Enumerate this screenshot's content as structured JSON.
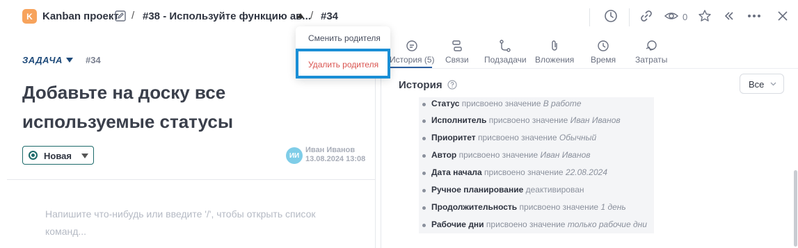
{
  "header": {
    "project_badge": "K",
    "project_name": "Kanban проект",
    "crumb_parent": "#38 - Используйте функцию ав...",
    "crumb_current": "#34",
    "separator": "/",
    "watchers_count": "0"
  },
  "task": {
    "type_label": "ЗАДАЧА",
    "number": "#34",
    "title": "Добавьте на доску все используемые статусы",
    "status": "Новая",
    "author_initials": "ИИ",
    "author_name": "Иван Иванов",
    "author_date": "13.08.2024 13:08",
    "editor_placeholder": "Напишите что-нибудь или введите '/', чтобы открыть список команд..."
  },
  "menu": {
    "items": [
      "Сменить родителя",
      "Удалить родителя"
    ]
  },
  "tabs": [
    {
      "label": "История (5)",
      "icon": "history-icon"
    },
    {
      "label": "Связи",
      "icon": "links-icon"
    },
    {
      "label": "Подзадачи",
      "icon": "subtasks-icon"
    },
    {
      "label": "Вложения",
      "icon": "attachment-icon"
    },
    {
      "label": "Время",
      "icon": "clock-icon"
    },
    {
      "label": "Затраты",
      "icon": "costs-icon"
    }
  ],
  "history": {
    "title": "История",
    "filter": "Все",
    "items": [
      {
        "field": "Статус",
        "action": "присвоено значение",
        "value": "В работе"
      },
      {
        "field": "Исполнитель",
        "action": "присвоено значение",
        "value": "Иван Иванов"
      },
      {
        "field": "Приоритет",
        "action": "присвоено значение",
        "value": "Обычный"
      },
      {
        "field": "Автор",
        "action": "присвоено значение",
        "value": "Иван Иванов"
      },
      {
        "field": "Дата начала",
        "action": "присвоено значение",
        "value": "22.08.2024"
      },
      {
        "field": "Ручное планирование",
        "action": "деактивирован",
        "value": ""
      },
      {
        "field": "Продолжительность",
        "action": "присвоено значение",
        "value": "1 день"
      },
      {
        "field": "Рабочие дни",
        "action": "присвоено значение",
        "value": "только рабочие дни"
      }
    ]
  },
  "colors": {
    "accent": "#1e4a7a",
    "status": "#1e6b6b",
    "danger": "#d9534f",
    "highlight": "#1a8fd6",
    "badge": "#f7a35c"
  }
}
